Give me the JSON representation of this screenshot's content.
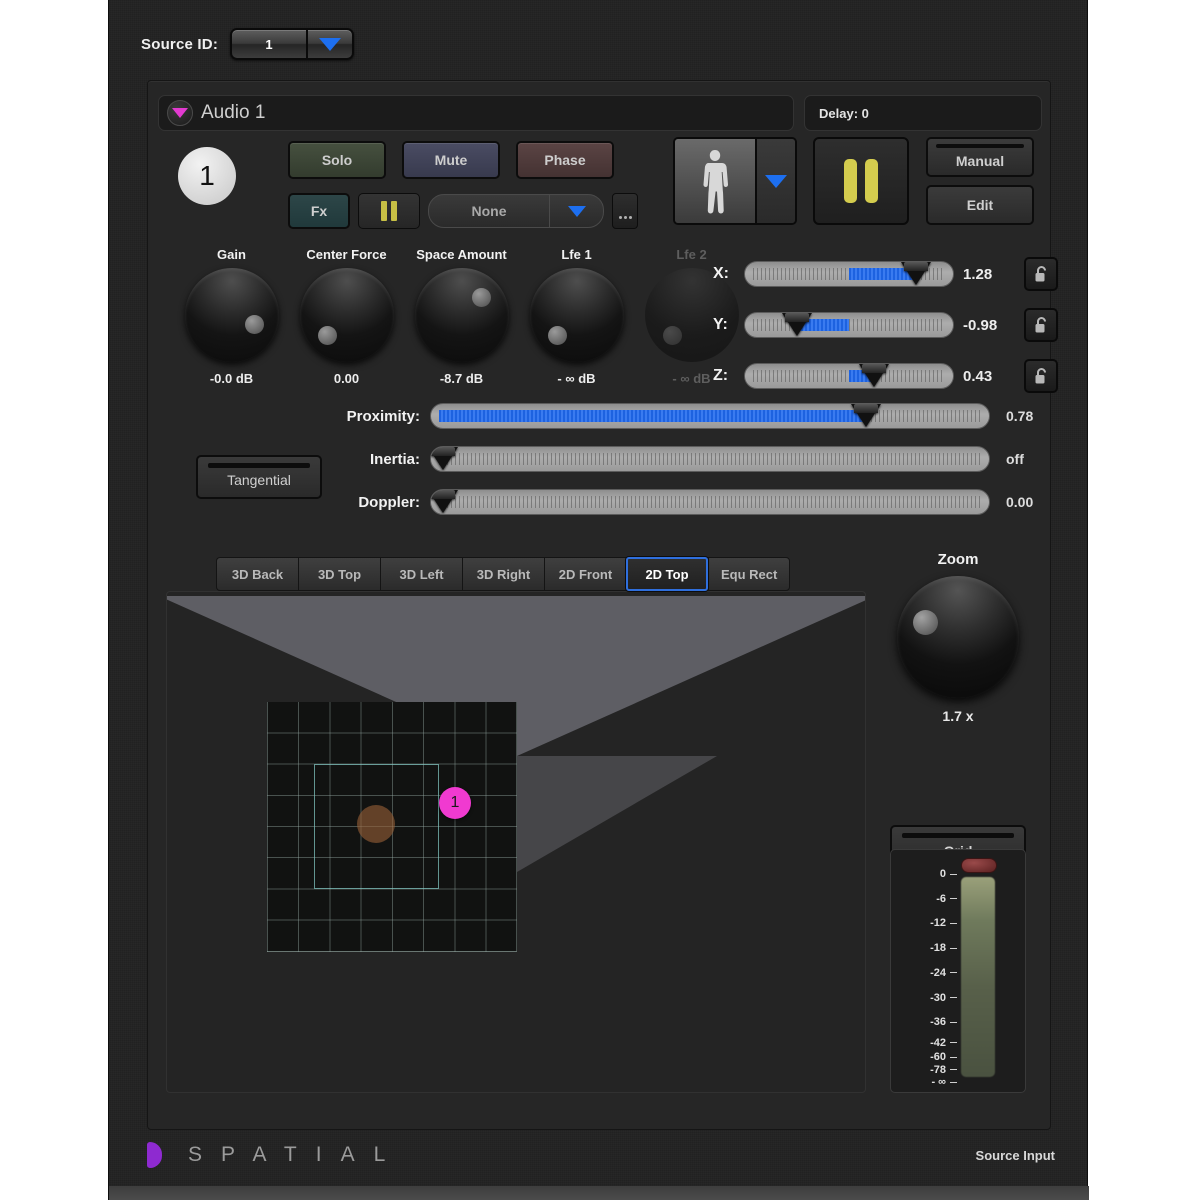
{
  "source_id": {
    "label": "Source ID:",
    "value": "1",
    "arrow_icon": "chevron-down-icon"
  },
  "header": {
    "name": "Audio 1",
    "delay": "Delay: 0",
    "disclosure_icon": "triangle-down-icon"
  },
  "channel": {
    "number": "1",
    "solo": "Solo",
    "mute": "Mute",
    "phase": "Phase",
    "fx": "Fx",
    "fx_preset": "None",
    "more": "...",
    "pause_icon": "pause-icon"
  },
  "transport": {
    "person_icon": "person-icon",
    "person_arrow_icon": "chevron-down-icon",
    "pause_icon": "pause-icon",
    "manual": "Manual",
    "edit": "Edit"
  },
  "knobs": [
    {
      "label": "Gain",
      "value": "-0.0 dB",
      "angle": 152,
      "disabled": false
    },
    {
      "label": "Center Force",
      "value": "0.00",
      "angle": 222,
      "disabled": false
    },
    {
      "label": "Space Amount",
      "value": "-8.7 dB",
      "angle": 45,
      "disabled": false
    },
    {
      "label": "Lfe 1",
      "value": "- ∞ dB",
      "angle": 222,
      "disabled": false
    },
    {
      "label": "Lfe 2",
      "value": "- ∞ dB",
      "angle": 222,
      "disabled": true
    }
  ],
  "position": [
    {
      "label": "X:",
      "value": "1.28",
      "pct": 82,
      "fill_from": 50,
      "lock_icon": "unlock-icon"
    },
    {
      "label": "Y:",
      "value": "-0.98",
      "pct": 25,
      "fill_from": 25,
      "lock_icon": "unlock-icon"
    },
    {
      "label": "Z:",
      "value": "0.43",
      "pct": 62,
      "fill_from": 50,
      "lock_icon": "unlock-icon"
    }
  ],
  "dynamics": {
    "tangential": "Tangential",
    "rows": [
      {
        "label": "Proximity:",
        "value": "0.78",
        "pct": 78,
        "fill_from": 0
      },
      {
        "label": "Inertia:",
        "value": "off",
        "pct": 1,
        "fill_from": 0
      },
      {
        "label": "Doppler:",
        "value": "0.00",
        "pct": 1,
        "fill_from": 0
      }
    ]
  },
  "view_tabs": [
    {
      "label": "3D Back",
      "active": false
    },
    {
      "label": "3D Top",
      "active": false
    },
    {
      "label": "3D Left",
      "active": false
    },
    {
      "label": "3D Right",
      "active": false
    },
    {
      "label": "2D Front",
      "active": false
    },
    {
      "label": "2D Top",
      "active": true
    },
    {
      "label": "Equ Rect",
      "active": false
    }
  ],
  "viewport": {
    "source_marker": "1",
    "grid_cells": 8,
    "listener_icon": "listener-dot",
    "cone_icon": "listener-cone"
  },
  "zoom": {
    "label": "Zoom",
    "value": "1.7 x"
  },
  "grid_button": {
    "label": "Grid"
  },
  "meter": {
    "ticks": [
      "0",
      "-6",
      "-12",
      "-18",
      "-24",
      "-30",
      "-36",
      "-42",
      "-60",
      "-78",
      "- ∞"
    ],
    "tick_positions": [
      0,
      12,
      24,
      36,
      48,
      60,
      72,
      84,
      90,
      95,
      100
    ],
    "clip_icon": "clip-led",
    "level_pct": 100
  },
  "footer": {
    "logo_icon": "spatial-logo-mark",
    "wordmark": "SPATIAL",
    "right_label": "Source Input"
  },
  "colors": {
    "accent_pink": "#f03ad0",
    "accent_blue": "#1d62e0",
    "tab_focus": "#2f6fdd",
    "logo_purple": "#8e2ad0",
    "pause_yellow": "#d4cc4e"
  }
}
